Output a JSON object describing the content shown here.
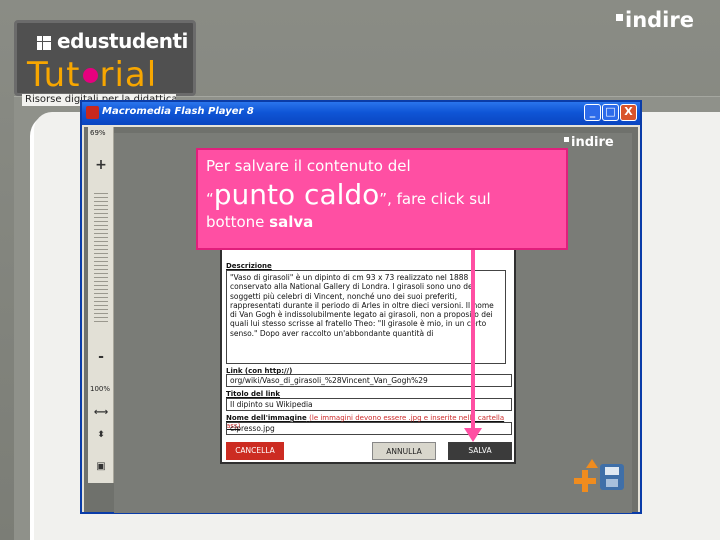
{
  "branding": {
    "edustudenti": "edustudenti",
    "tutorial": "Tutorial",
    "subtitle": "Risorse digitali per la didattica",
    "indire": "indire"
  },
  "window": {
    "title": "Macromedia Flash Player 8",
    "minimize": "_",
    "maximize": "□",
    "close": "X",
    "indire_small": "indire"
  },
  "toolbar": {
    "zoom_level": "69%",
    "zoom_in": "+",
    "zoom_out": "-",
    "reset": "100%"
  },
  "dialog": {
    "description_label": "Descrizione",
    "description_text": "\"Vaso di girasoli\" è un dipinto di cm 93 x 73 realizzato nel 1888 conservato alla National Gallery di Londra. I girasoli sono uno dei soggetti più celebri di Vincent, nonché uno dei suoi preferiti, rappresentati durante il periodo di Arles in oltre dieci versioni. Il nome di Van Gogh è indissolubilmente legato ai girasoli, non a proposito dei quali lui stesso scrisse al fratello Theo: \"Il girasole è mio, in un certo senso.\" Dopo aver raccolto un'abbondante quantità di",
    "link_label": "Link (con http://)",
    "link_value": "org/wiki/Vaso_di_girasoli_%28Vincent_Van_Gogh%29",
    "link_title_label": "Titolo del link",
    "link_title_value": "Il dipinto su Wikipedia",
    "image_name_label": "Nome dell'immagine",
    "image_name_note": "(le immagini devono essere .jpg e inserite nella cartella ass)",
    "image_name_value": "cipresso.jpg",
    "cancel_button": "CANCELLA",
    "annulla_button": "ANNULLA",
    "salva_button": "SALVA"
  },
  "callout": {
    "line1": "Per salvare il contenuto del",
    "quote_open": "“",
    "big_text": "punto caldo",
    "after_big": "”, fare click sul",
    "line3_prefix": "bottone",
    "line3_bold": "salva"
  },
  "colors": {
    "callout": "#ff4fa3",
    "accent_orange": "#f7a600",
    "titlebar_blue": "#0f55d6"
  }
}
